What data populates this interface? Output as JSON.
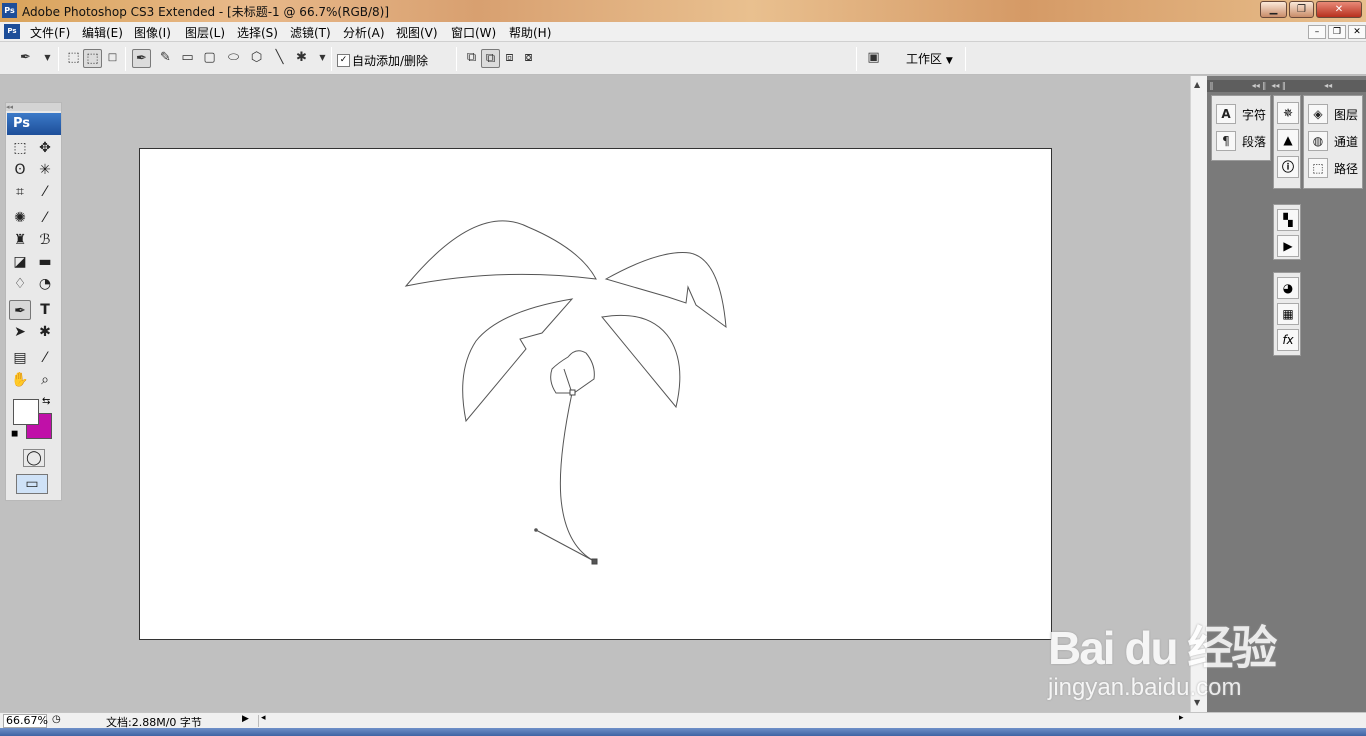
{
  "window": {
    "title": "Adobe Photoshop CS3 Extended - [未标题-1 @ 66.7%(RGB/8)]",
    "app_icon": "Ps"
  },
  "menu": {
    "items": [
      "文件(F)",
      "编辑(E)",
      "图像(I)",
      "图层(L)",
      "选择(S)",
      "滤镜(T)",
      "分析(A)",
      "视图(V)",
      "窗口(W)",
      "帮助(H)"
    ]
  },
  "options_bar": {
    "auto_add_delete": {
      "label": "自动添加/删除",
      "checked": true
    },
    "workspace_label": "工作区"
  },
  "toolbox": {
    "header": "Ps",
    "foreground_color": "#ffffff",
    "background_color": "#c010a8"
  },
  "panels": {
    "group1": [
      {
        "icon": "character-icon",
        "label": "字符"
      },
      {
        "icon": "paragraph-icon",
        "label": "段落"
      }
    ],
    "group3": [
      {
        "icon": "layers-icon",
        "label": "图层"
      },
      {
        "icon": "channels-icon",
        "label": "通道"
      },
      {
        "icon": "paths-icon",
        "label": "路径"
      }
    ]
  },
  "status": {
    "zoom": "66.67%",
    "doc_info": "文档:2.88M/0 字节"
  },
  "watermark": {
    "brand": "Bai du 经验",
    "url": "jingyan.baidu.com"
  },
  "colors": {
    "selected_tool": "pen-tool",
    "accent": "#1d4e99"
  }
}
